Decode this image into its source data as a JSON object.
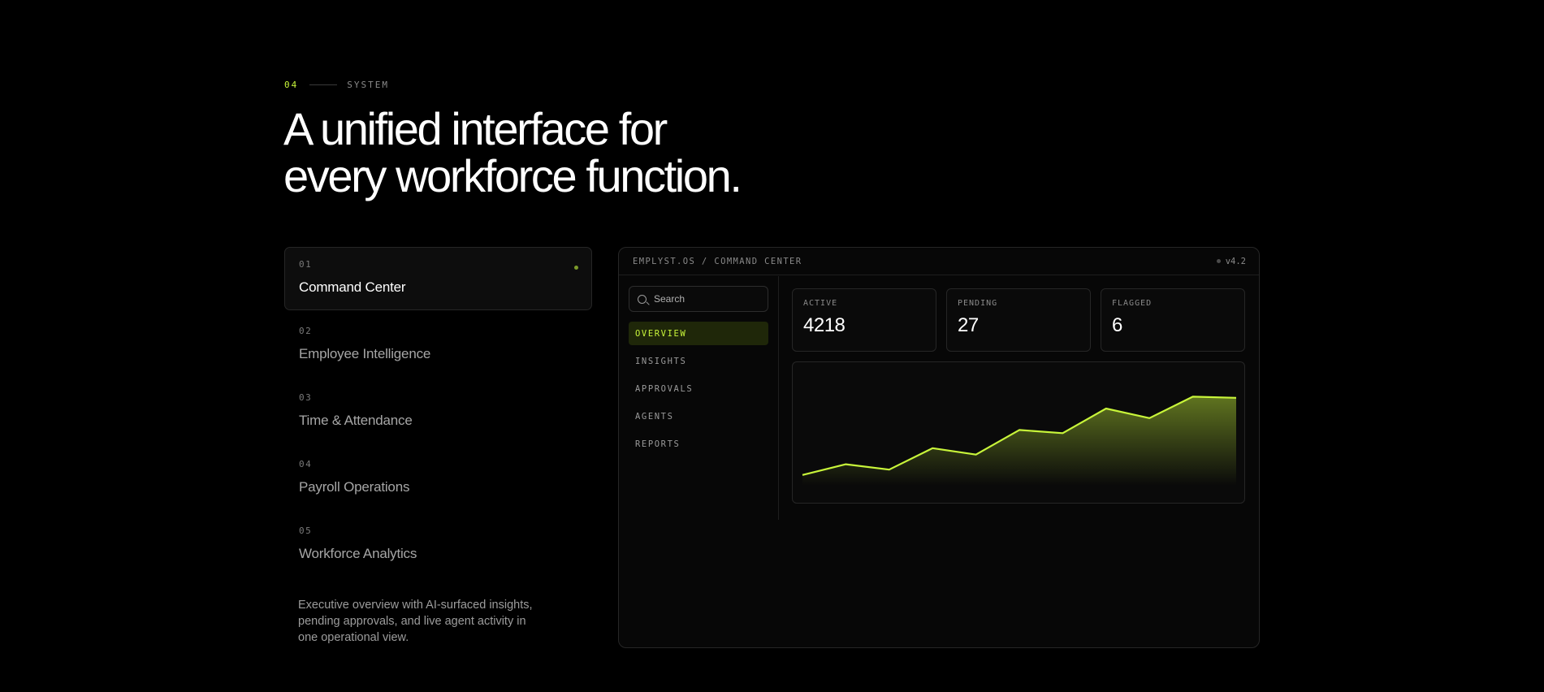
{
  "section": {
    "number": "04",
    "label": "SYSTEM"
  },
  "headline": {
    "line1": "A unified interface for",
    "line2": "every workforce function."
  },
  "modules": [
    {
      "num": "01",
      "title": "Command Center",
      "active": true
    },
    {
      "num": "02",
      "title": "Employee Intelligence",
      "active": false
    },
    {
      "num": "03",
      "title": "Time & Attendance",
      "active": false
    },
    {
      "num": "04",
      "title": "Payroll Operations",
      "active": false
    },
    {
      "num": "05",
      "title": "Workforce Analytics",
      "active": false
    }
  ],
  "description": "Executive overview with AI-surfaced insights, pending approvals, and live agent activity in one operational view.",
  "panel": {
    "breadcrumb": "EMPLYST.OS / COMMAND CENTER",
    "version": "v4.2",
    "search": {
      "placeholder": "Search",
      "value": ""
    },
    "nav": [
      "OVERVIEW",
      "INSIGHTS",
      "APPROVALS",
      "AGENTS",
      "REPORTS"
    ],
    "nav_active_index": 0,
    "stats": [
      {
        "label": "ACTIVE",
        "value": "4218"
      },
      {
        "label": "PENDING",
        "value": "27"
      },
      {
        "label": "FLAGGED",
        "value": "6"
      }
    ]
  },
  "colors": {
    "accent": "#c8f53a",
    "background": "#000000",
    "panel": "#070707",
    "border": "#262626"
  },
  "chart_data": {
    "type": "area",
    "x": [
      0,
      1,
      2,
      3,
      4,
      5,
      6,
      7,
      8,
      9,
      10
    ],
    "values": [
      10,
      20,
      15,
      35,
      29,
      52,
      49,
      72,
      63,
      83,
      82
    ],
    "ylim": [
      0,
      100
    ],
    "grid": false,
    "color": "#c8f53a"
  }
}
